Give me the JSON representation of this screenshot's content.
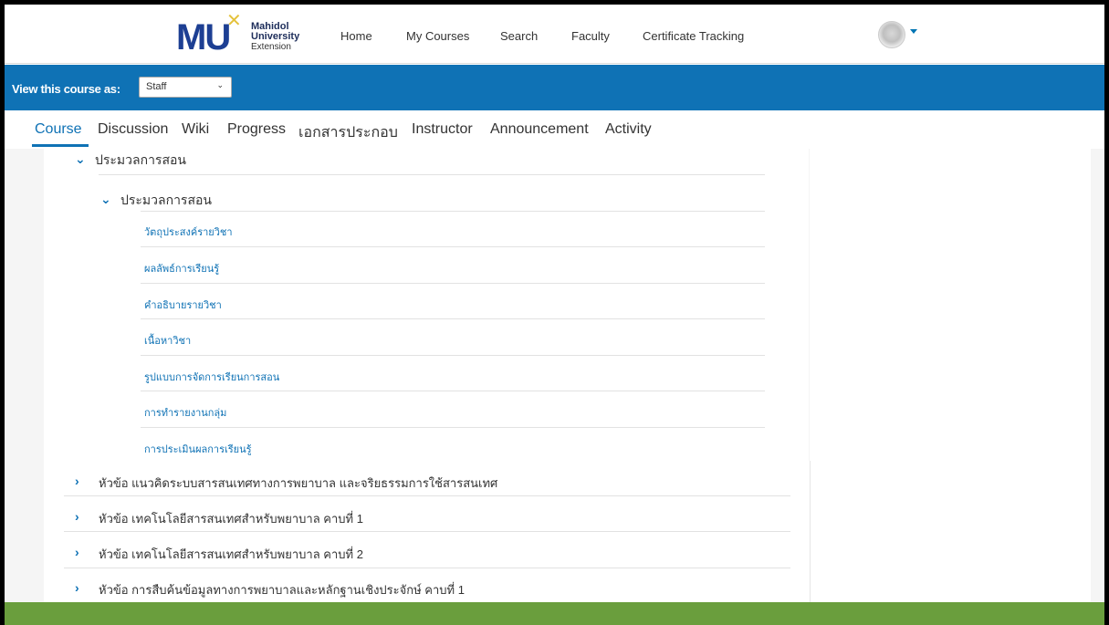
{
  "header": {
    "logo_mu": "MU",
    "logo_lines": [
      "Mahidol",
      "University",
      "Extension"
    ],
    "nav": [
      "Home",
      "My Courses",
      "Search",
      "Faculty",
      "Certificate Tracking"
    ]
  },
  "staff_bar": {
    "label": "View this course as:",
    "select_value": "Staff"
  },
  "tabs": [
    "Course",
    "Discussion",
    "Wiki",
    "Progress",
    "เอกสารประกอบ",
    "Instructor",
    "Announcement",
    "Activity"
  ],
  "outline": {
    "section_title": "ประมวลการสอน",
    "subsection_title": "ประมวลการสอน",
    "units": [
      "วัตถุประสงค์รายวิชา",
      "ผลลัพธ์การเรียนรู้",
      "คำอธิบายรายวิชา",
      "เนื้อหาวิชา",
      "รูปแบบการจัดการเรียนการสอน",
      "การทำรายงานกลุ่ม",
      "การประเมินผลการเรียนรู้"
    ],
    "chapters": [
      "หัวข้อ แนวคิดระบบสารสนเทศทางการพยาบาล และจริยธรรมการใช้สารสนเทศ",
      "หัวข้อ เทคโนโลยีสารสนเทศสำหรับพยาบาล คาบที่ 1",
      "หัวข้อ เทคโนโลยีสารสนเทศสำหรับพยาบาล คาบที่ 2",
      "หัวข้อ การสืบค้นข้อมูลทางการพยาบาลและหลักฐานเชิงประจักษ์ คาบที่ 1"
    ]
  },
  "colors": {
    "brand_blue": "#0f72b5",
    "footer_green": "#6a9e3d"
  }
}
